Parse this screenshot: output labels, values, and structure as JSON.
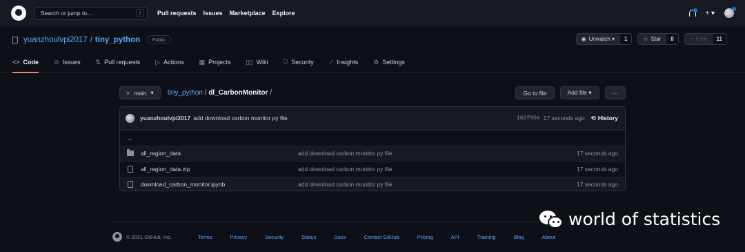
{
  "header": {
    "search_placeholder": "Search or jump to...",
    "search_key": "/",
    "nav": [
      "Pull requests",
      "Issues",
      "Marketplace",
      "Explore"
    ],
    "plus_label": "+ ▾"
  },
  "repo": {
    "owner": "yuanzhoulvpi2017",
    "separator": "/",
    "name": "tiny_python",
    "visibility": "Public",
    "unwatch_label": "Unwatch ▾",
    "watch_count": "1",
    "star_label": "Star",
    "star_count": "8",
    "fork_label": "Fork",
    "fork_count": "11"
  },
  "tabs": [
    {
      "icon": "<>",
      "label": "Code"
    },
    {
      "icon": "⊙",
      "label": "Issues"
    },
    {
      "icon": "⇅",
      "label": "Pull requests"
    },
    {
      "icon": "▷",
      "label": "Actions"
    },
    {
      "icon": "▦",
      "label": "Projects"
    },
    {
      "icon": "▯▯",
      "label": "Wiki"
    },
    {
      "icon": "⛉",
      "label": "Security"
    },
    {
      "icon": "⟋",
      "label": "Insights"
    },
    {
      "icon": "⚙",
      "label": "Settings"
    }
  ],
  "browser": {
    "branch": "main",
    "crumb_repo": "tiny_python",
    "crumb_sep": "/",
    "crumb_dir": "dl_CarbonMonitor",
    "crumb_trail": "/",
    "goto_file": "Go to file",
    "add_file": "Add file ▾",
    "more": "···"
  },
  "commit": {
    "user": "yuanzhoulvpi2017",
    "message": "add download carbon monitor py file",
    "sha": "162f95e",
    "age": "17 seconds ago",
    "history": "History"
  },
  "files": {
    "up": "..",
    "rows": [
      {
        "name": "all_region_data",
        "message": "add download carbon monitor py file",
        "age": "17 seconds ago"
      },
      {
        "name": "all_region_data.zip",
        "message": "add download carbon monitor py file",
        "age": "17 seconds ago"
      },
      {
        "name": "download_carbon_monitor.ipynb",
        "message": "add download carbon monitor py file",
        "age": "17 seconds ago"
      }
    ]
  },
  "footer": {
    "copyright": "© 2021 GitHub, Inc.",
    "links": [
      "Terms",
      "Privacy",
      "Security",
      "Status",
      "Docs",
      "Contact GitHub",
      "Pricing",
      "API",
      "Training",
      "Blog",
      "About"
    ]
  },
  "watermark": {
    "text": "world of statistics"
  }
}
